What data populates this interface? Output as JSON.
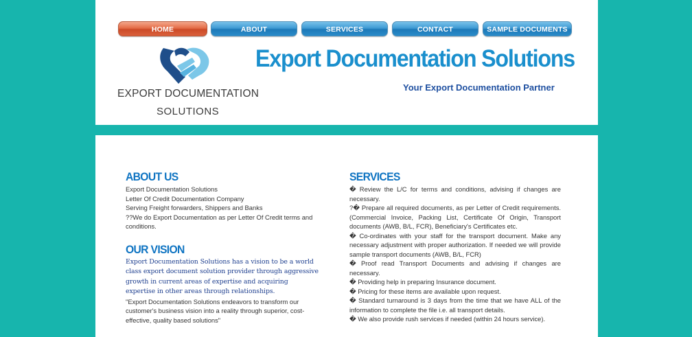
{
  "nav": {
    "items": [
      {
        "label": "HOME",
        "active": true
      },
      {
        "label": "ABOUT",
        "active": false
      },
      {
        "label": "SERVICES",
        "active": false
      },
      {
        "label": "CONTACT",
        "active": false
      },
      {
        "label": "SAMPLE DOCUMENTS",
        "active": false
      }
    ]
  },
  "logo": {
    "icon": "handshake-icon",
    "line1": "EXPORT DOCUMENTATION",
    "line2": "SOLUTIONS"
  },
  "header": {
    "title": "Export Documentation Solutions",
    "tagline": "Your Export Documentation Partner"
  },
  "about": {
    "heading": "ABOUT US",
    "lines": [
      "Export Documentation Solutions",
      "Letter Of Credit Documentation Company",
      "Serving Freight forwarders, Shippers and Banks",
      "??We do Export Documentation as per Letter Of Credit terms and conditions."
    ]
  },
  "vision": {
    "heading": "OUR VISION",
    "serif_text": "Export Documentation Solutions has a vision to be a world class export document solution provider through aggressive growth in current areas of expertise and acquiring expertise in other areas through relationships.",
    "quote": "\"Export Documentation Solutions endeavors to transform our customer's business vision into a reality through superior, cost-effective, quality based solutions\""
  },
  "services": {
    "heading": "SERVICES",
    "items": [
      "� Review the L/C for terms and conditions, advising if changes are necessary.",
      "?� Prepare all required documents, as per Letter of Credit requirements. (Commercial Invoice, Packing List, Certificate Of Origin, Transport documents (AWB, B/L, FCR), Beneficiary's Certificates etc.",
      "� Co-ordinates with your staff for the transport document. Make any necessary adjustment with proper authorization. If needed we will provide sample transport documents (AWB, B/L, FCR)",
      "� Proof read Transport Documents and advising if changes are necessary.",
      "� Providing help in preparing Insurance document.",
      "� Pricing for these items are available upon request.",
      "� Standard turnaround is 3 days from the time that we have ALL of the information to complete the file i.e. all transport details.",
      "� We also provide rush services if needed (within 24 hours service)."
    ]
  },
  "colors": {
    "background": "#17b5ad",
    "title": "#1a8fcd",
    "tagline": "#1e4fa0",
    "nav_blue": "#2a8bc9",
    "nav_active": "#d9603b"
  }
}
